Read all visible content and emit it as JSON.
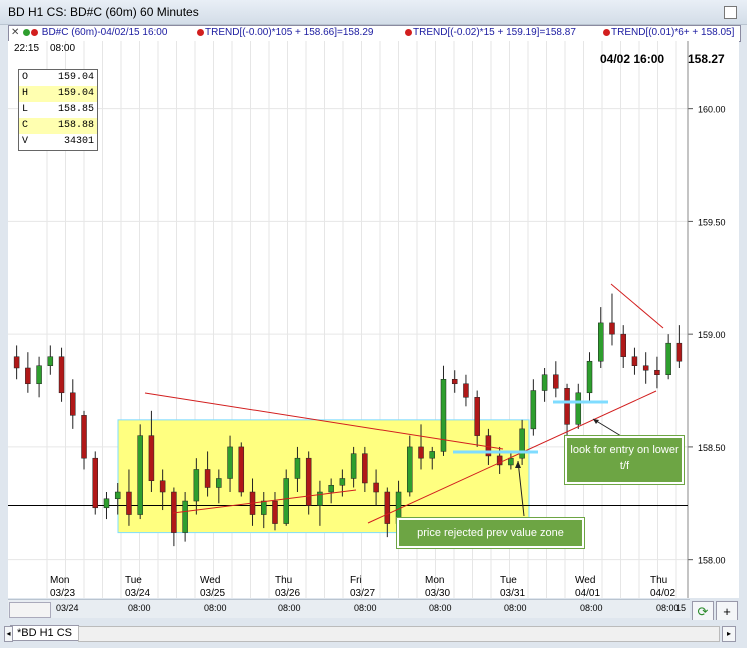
{
  "window": {
    "title": "BD H1 CS: BD#C (60m) 60 Minutes"
  },
  "study_bar": {
    "symbol": "BD#C (60m)-04/02/15 16:00",
    "trend1": "TREND[(-0.00)*105 + 158.66]=158.29",
    "trend2": "TREND[(-0.02)*15 + 159.19]=158.87",
    "trend3": "TREND[(0.01)*6+ + 158.05]"
  },
  "header": {
    "time1": "22:15",
    "time2": "08:00",
    "date": "04/02 16:00",
    "price": "158.27"
  },
  "ohlc": [
    {
      "k": "O",
      "v": "159.04",
      "hl": false
    },
    {
      "k": "H",
      "v": "159.04",
      "hl": true
    },
    {
      "k": "L",
      "v": "158.85",
      "hl": false
    },
    {
      "k": "C",
      "v": "158.88",
      "hl": true
    },
    {
      "k": "V",
      "v": "34301",
      "hl": false
    }
  ],
  "price_labels": [
    "160.00",
    "159.50",
    "159.00",
    "158.50",
    "158.00"
  ],
  "day_labels": [
    {
      "day": "Mon",
      "date": "03/23"
    },
    {
      "day": "Tue",
      "date": "03/24"
    },
    {
      "day": "Wed",
      "date": "03/25"
    },
    {
      "day": "Thu",
      "date": "03/26"
    },
    {
      "day": "Fri",
      "date": "03/27"
    },
    {
      "day": "Mon",
      "date": "03/30"
    },
    {
      "day": "Tue",
      "date": "03/31"
    },
    {
      "day": "Wed",
      "date": "04/01"
    },
    {
      "day": "Thu",
      "date": "04/02"
    }
  ],
  "time_scale": [
    "03/24",
    "08:00",
    "08:00",
    "08:00",
    "08:00",
    "08:00",
    "08:00",
    "08:00",
    "08:00",
    "15"
  ],
  "annotations": {
    "entry": "look for entry on lower t/f",
    "rejected": "price rejected prev value zone"
  },
  "tabs": {
    "active": "*BD H1 CS"
  },
  "colors": {
    "up": "#2e9e2e",
    "down": "#b01818",
    "zone": "#ffff80",
    "zone_border": "#7fdcff",
    "trend": "#d21e1e",
    "annot_bg": "#6da544"
  },
  "chart_data": {
    "type": "candlestick",
    "ylim": [
      157.83,
      160.3
    ],
    "candles": [
      [
        158.9,
        158.95,
        158.8,
        158.85
      ],
      [
        158.85,
        158.92,
        158.74,
        158.78
      ],
      [
        158.78,
        158.9,
        158.72,
        158.86
      ],
      [
        158.86,
        158.95,
        158.82,
        158.9
      ],
      [
        158.9,
        158.94,
        158.7,
        158.74
      ],
      [
        158.74,
        158.8,
        158.58,
        158.64
      ],
      [
        158.64,
        158.66,
        158.4,
        158.45
      ],
      [
        158.45,
        158.48,
        158.2,
        158.23
      ],
      [
        158.23,
        158.3,
        158.18,
        158.27
      ],
      [
        158.27,
        158.34,
        158.2,
        158.3
      ],
      [
        158.3,
        158.4,
        158.15,
        158.2
      ],
      [
        158.2,
        158.6,
        158.18,
        158.55
      ],
      [
        158.55,
        158.66,
        158.3,
        158.35
      ],
      [
        158.35,
        158.4,
        158.22,
        158.3
      ],
      [
        158.3,
        158.32,
        158.06,
        158.12
      ],
      [
        158.12,
        158.3,
        158.08,
        158.26
      ],
      [
        158.26,
        158.45,
        158.2,
        158.4
      ],
      [
        158.4,
        158.48,
        158.28,
        158.32
      ],
      [
        158.32,
        158.4,
        158.25,
        158.36
      ],
      [
        158.36,
        158.55,
        158.3,
        158.5
      ],
      [
        158.5,
        158.52,
        158.28,
        158.3
      ],
      [
        158.3,
        158.36,
        158.15,
        158.2
      ],
      [
        158.2,
        158.3,
        158.14,
        158.26
      ],
      [
        158.26,
        158.3,
        158.13,
        158.16
      ],
      [
        158.16,
        158.4,
        158.15,
        158.36
      ],
      [
        158.36,
        158.5,
        158.3,
        158.45
      ],
      [
        158.45,
        158.48,
        158.2,
        158.24
      ],
      [
        158.24,
        158.35,
        158.15,
        158.3
      ],
      [
        158.3,
        158.36,
        158.25,
        158.33
      ],
      [
        158.33,
        158.4,
        158.28,
        158.36
      ],
      [
        158.36,
        158.5,
        158.32,
        158.47
      ],
      [
        158.47,
        158.5,
        158.3,
        158.34
      ],
      [
        158.34,
        158.4,
        158.24,
        158.3
      ],
      [
        158.3,
        158.32,
        158.1,
        158.16
      ],
      [
        158.16,
        158.35,
        158.05,
        158.3
      ],
      [
        158.3,
        158.55,
        158.28,
        158.5
      ],
      [
        158.5,
        158.6,
        158.4,
        158.45
      ],
      [
        158.45,
        158.5,
        158.4,
        158.48
      ],
      [
        158.48,
        158.86,
        158.46,
        158.8
      ],
      [
        158.8,
        158.84,
        158.74,
        158.78
      ],
      [
        158.78,
        158.82,
        158.68,
        158.72
      ],
      [
        158.72,
        158.75,
        158.5,
        158.55
      ],
      [
        158.55,
        158.58,
        158.42,
        158.46
      ],
      [
        158.46,
        158.5,
        158.38,
        158.42
      ],
      [
        158.42,
        158.48,
        158.4,
        158.45
      ],
      [
        158.45,
        158.62,
        158.42,
        158.58
      ],
      [
        158.58,
        158.8,
        158.55,
        158.75
      ],
      [
        158.75,
        158.85,
        158.7,
        158.82
      ],
      [
        158.82,
        158.88,
        158.72,
        158.76
      ],
      [
        158.76,
        158.78,
        158.55,
        158.6
      ],
      [
        158.6,
        158.78,
        158.58,
        158.74
      ],
      [
        158.74,
        158.92,
        158.7,
        158.88
      ],
      [
        158.88,
        159.12,
        158.85,
        159.05
      ],
      [
        159.05,
        159.18,
        158.95,
        159.0
      ],
      [
        159.0,
        159.04,
        158.85,
        158.9
      ],
      [
        158.9,
        158.94,
        158.82,
        158.86
      ],
      [
        158.86,
        158.92,
        158.78,
        158.84
      ],
      [
        158.84,
        158.9,
        158.76,
        158.82
      ],
      [
        158.82,
        159.0,
        158.8,
        158.96
      ],
      [
        158.96,
        159.04,
        158.85,
        158.88
      ]
    ]
  }
}
